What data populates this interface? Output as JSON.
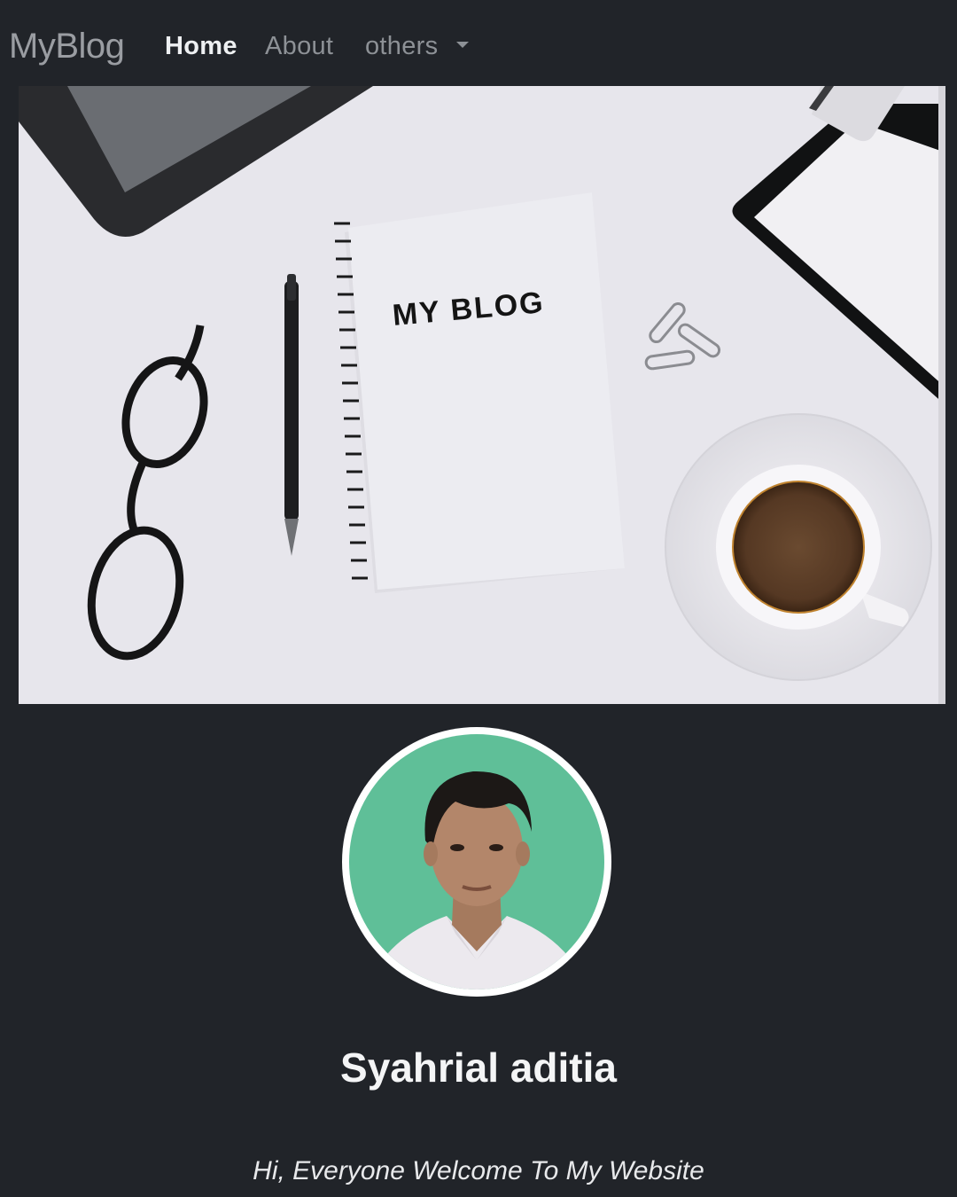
{
  "navbar": {
    "brand": "MyBlog",
    "links": [
      {
        "label": "Home"
      },
      {
        "label": "About"
      },
      {
        "label": "others"
      }
    ]
  },
  "hero": {
    "notebook_title": "MY BLOG"
  },
  "profile": {
    "name": "Syahrial aditia",
    "welcome": "Hi, Everyone Welcome To My Website"
  },
  "colors": {
    "background": "#212429",
    "nav_active": "#eef0f2",
    "nav_inactive": "#8d9196",
    "hero_background": "#e7e6ec",
    "avatar_backdrop": "#5fbf98"
  }
}
